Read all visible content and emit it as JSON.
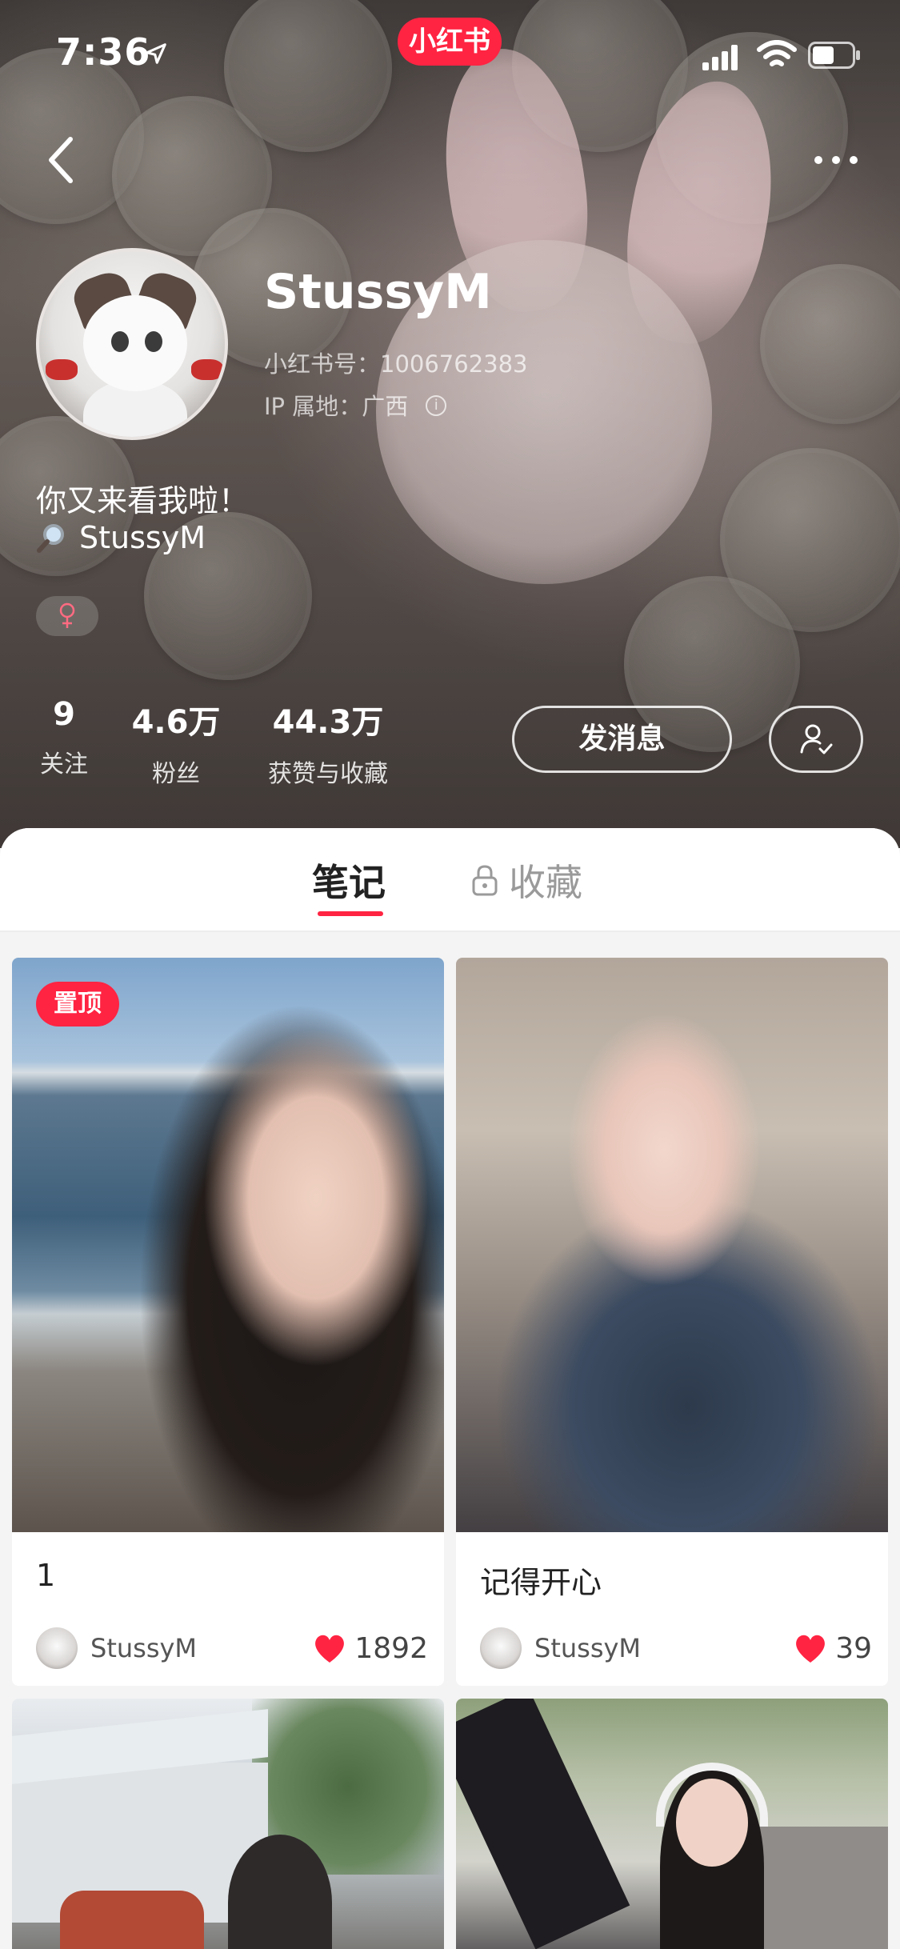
{
  "status_bar": {
    "time": "7:36",
    "app_badge": "小红书"
  },
  "profile": {
    "name": "StussyM",
    "red_id": "小红书号：1006762383",
    "ip_location": "IP 属地：广西",
    "bio_line1": "你又来看我啦！",
    "bio_line2": "StussyM",
    "gender_symbol": "♀"
  },
  "stats": [
    {
      "value": "9",
      "label": "关注"
    },
    {
      "value": "4.6万",
      "label": "粉丝"
    },
    {
      "value": "44.3万",
      "label": "获赞与收藏"
    }
  ],
  "actions": {
    "message_label": "发消息"
  },
  "tabs": {
    "notes": "笔记",
    "collections": "收藏"
  },
  "notes": [
    {
      "pinned_label": "置顶",
      "title": "1",
      "author": "StussyM",
      "likes": "1892"
    },
    {
      "title": "记得开心",
      "author": "StussyM",
      "likes": "39"
    }
  ],
  "colors": {
    "brand": "#ff2442",
    "heart": "#ff2442"
  }
}
